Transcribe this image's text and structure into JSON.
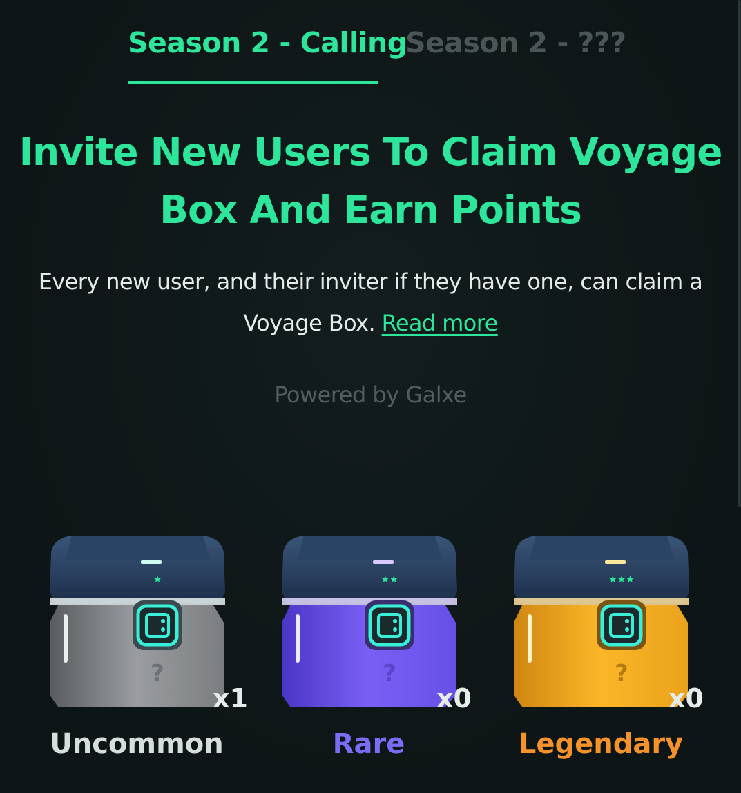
{
  "tabs": [
    {
      "label": "Season 2 - Calling",
      "active": true
    },
    {
      "label": "Season 2 - ???",
      "active": false
    }
  ],
  "headline": "Invite New Users To Claim Voyage Box And Earn Points",
  "description": {
    "text": "Every new user, and their inviter if they have one, can claim a Voyage Box.",
    "link_label": "Read more"
  },
  "powered_by": "Powered by Galxe",
  "boxes": [
    {
      "tier": "Uncommon",
      "count": "x1",
      "stars": "★",
      "color": "#8a8d8f",
      "label_color": "#d6dedd",
      "icon": "mystery-box-icon"
    },
    {
      "tier": "Rare",
      "count": "x0",
      "stars": "★★",
      "color": "#7456f0",
      "label_color": "#7c6cf5",
      "icon": "mystery-box-icon"
    },
    {
      "tier": "Legendary",
      "count": "x0",
      "stars": "★★★",
      "color": "#f6a81d",
      "label_color": "#f5932a",
      "icon": "mystery-box-icon"
    }
  ],
  "colors": {
    "accent": "#2ee69b",
    "background": "#0f1718",
    "muted": "#4b5556"
  }
}
